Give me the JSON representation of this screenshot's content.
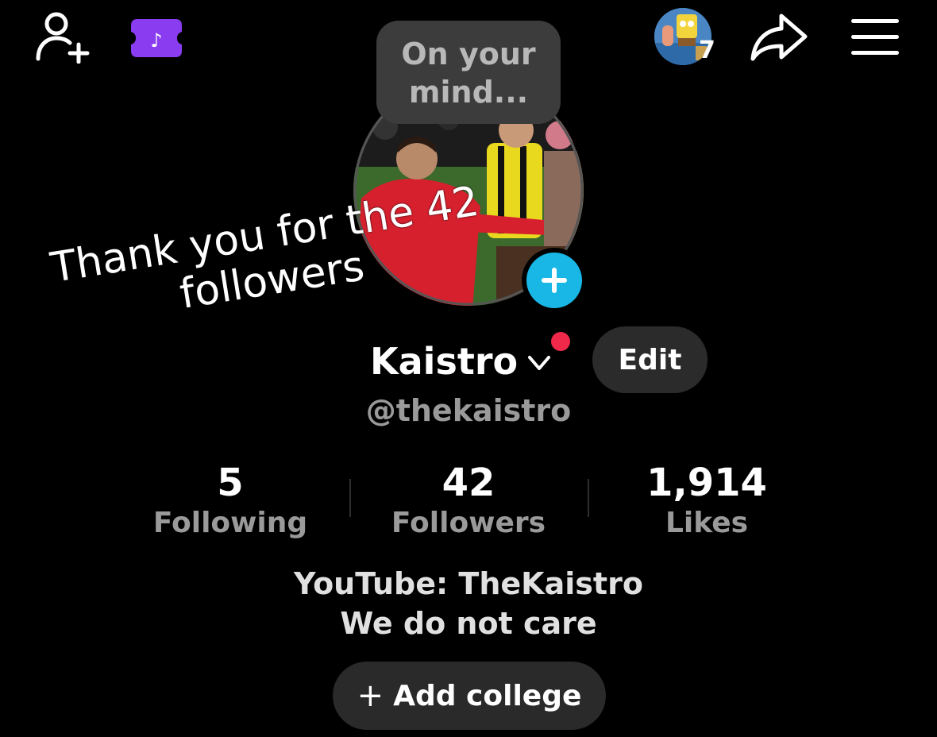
{
  "top_bar": {
    "add_friend_icon": "add-user-icon",
    "live_icon": "tiktok-ticket-icon",
    "story_count": "7",
    "share_icon": "share-arrow-icon",
    "menu_icon": "hamburger-menu-icon"
  },
  "mind_bubble": {
    "line1": "On your",
    "line2": "mind..."
  },
  "caption": {
    "line1": "Thank you for the 42",
    "line2": "followers"
  },
  "profile": {
    "name": "Kaistro",
    "edit_label": "Edit",
    "username": "@thekaistro",
    "accent_color": "#19b7e6",
    "notification_color": "#f0284a"
  },
  "stats": [
    {
      "value": "5",
      "label": "Following"
    },
    {
      "value": "42",
      "label": "Followers"
    },
    {
      "value": "1,914",
      "label": "Likes"
    }
  ],
  "bio": {
    "line1": "YouTube: TheKaistro",
    "line2": "We do not care"
  },
  "college_button": {
    "plus": "+",
    "label": "Add college"
  }
}
